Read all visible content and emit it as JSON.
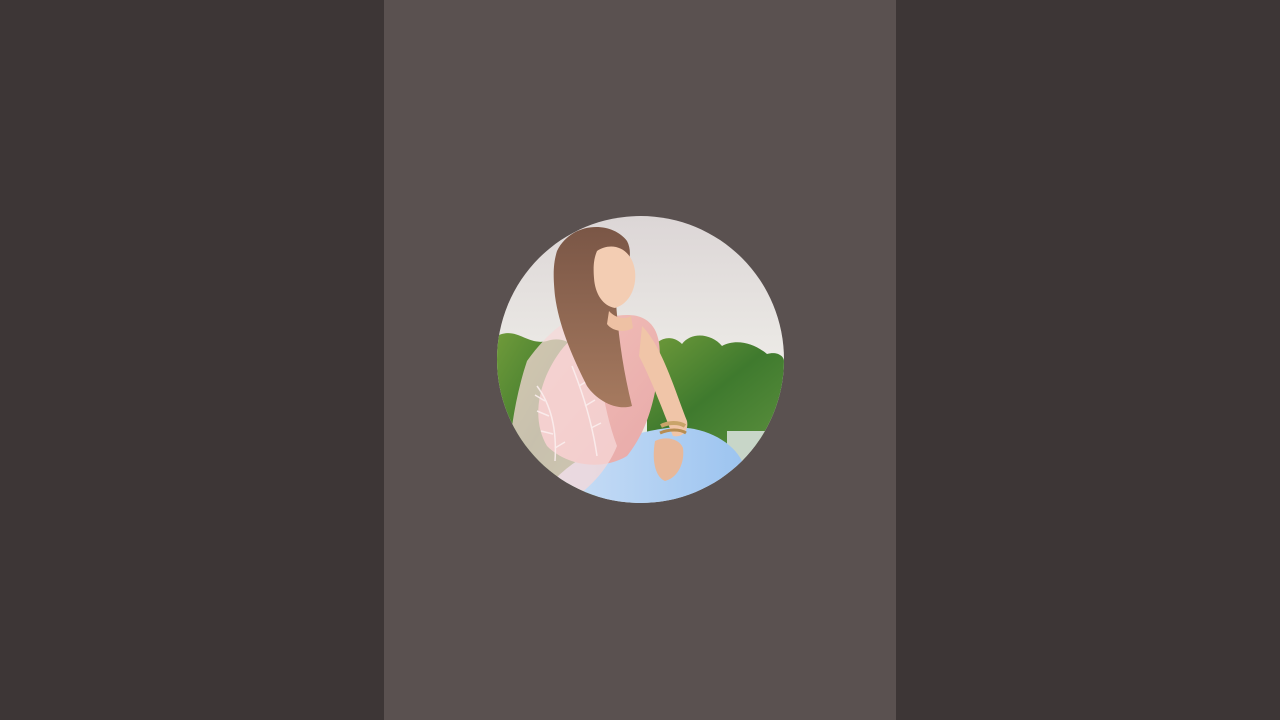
{
  "colors": {
    "backdrop": "#3d3636",
    "center_panel": "#5a5150"
  },
  "avatar": {
    "icon": "profile-photo",
    "description_label": ""
  }
}
